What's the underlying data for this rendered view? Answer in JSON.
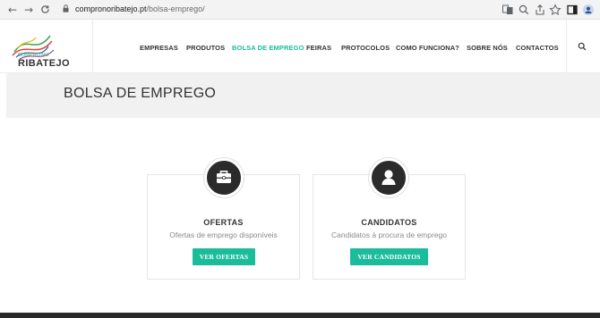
{
  "browser": {
    "url_domain": "compronoribatejo.pt",
    "url_path": "/bolsa-emprego/",
    "back_icon": "←",
    "forward_icon": "→",
    "reload_icon": "C",
    "tools": [
      "translate-icon",
      "zoom-icon",
      "share-icon",
      "star-icon",
      "sidebar-icon",
      "profile-icon"
    ]
  },
  "site": {
    "logo_top": "COMPRO NO",
    "logo_bottom": "RIBATEJO",
    "menu": [
      {
        "label": "EMPRESAS"
      },
      {
        "label": "PRODUTOS"
      },
      {
        "label": "BOLSA DE EMPREGO"
      },
      {
        "label": "FEIRAS"
      },
      {
        "label": "PROTOCOLOS"
      },
      {
        "label": "COMO FUNCIONA?"
      },
      {
        "label": "SOBRE NÓS"
      },
      {
        "label": "CONTACTOS"
      }
    ],
    "active_menu": "BOLSA DE EMPREGO",
    "accent": "#1bbc9b"
  },
  "page": {
    "title": "BOLSA DE EMPREGO"
  },
  "cards": [
    {
      "title": "OFERTAS",
      "subtitle": "Ofertas de emprego disponíveis",
      "button": "VER OFERTAS",
      "icon": "briefcase-icon"
    },
    {
      "title": "CANDIDATOS",
      "subtitle": "Candidatos à procura de emprego",
      "button": "VER CANDIDATOS",
      "icon": "user-icon"
    }
  ]
}
